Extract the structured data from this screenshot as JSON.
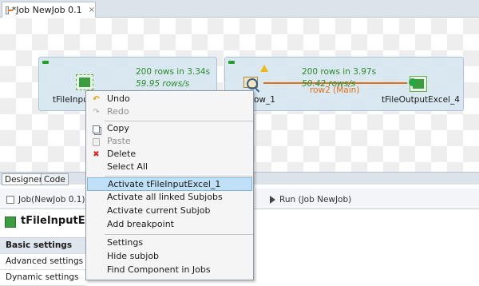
{
  "editor": {
    "tab_title": "*Job NewJob 0.1",
    "tab_close": "×"
  },
  "canvas": {
    "link1_stats": {
      "rows": "200 rows in 3.34s",
      "rate": "59.95 rows/s"
    },
    "link2_stats": {
      "rows": "200 rows in 3.97s",
      "rate": "50.42 rows/s"
    },
    "link2_label": "row2 (Main)",
    "components": [
      {
        "label": "tFileInpu"
      },
      {
        "label": "ow_1"
      },
      {
        "label": "tFileOutputExcel_4"
      }
    ]
  },
  "context_menu": {
    "items": [
      {
        "label": "Undo",
        "icon": "undo-icon",
        "enabled": true
      },
      {
        "label": "Redo",
        "icon": "redo-icon",
        "enabled": false
      },
      {
        "label": "Copy",
        "icon": "copy-icon",
        "enabled": true
      },
      {
        "label": "Paste",
        "icon": "paste-icon",
        "enabled": false
      },
      {
        "label": "Delete",
        "icon": "delete-icon",
        "enabled": true
      },
      {
        "label": "Select All",
        "enabled": true
      },
      {
        "label": "Activate tFileInputExcel_1",
        "enabled": true,
        "highlighted": true
      },
      {
        "label": "Activate all linked Subjobs",
        "enabled": true
      },
      {
        "label": "Activate current Subjob",
        "enabled": true
      },
      {
        "label": "Add breakpoint",
        "enabled": true
      },
      {
        "label": "Settings",
        "enabled": true
      },
      {
        "label": "Hide subjob",
        "enabled": true
      },
      {
        "label": "Find Component in Jobs",
        "enabled": true
      }
    ]
  },
  "bottom_tabs": {
    "designer": "Designer",
    "code": "Code"
  },
  "view_tabs": {
    "job": "Job(NewJob 0.1)",
    "run": "Run (Job NewJob)"
  },
  "component_panel": {
    "title": "tFileInputExc",
    "settings": [
      "Basic settings",
      "Advanced settings",
      "Dynamic settings"
    ]
  },
  "colors": {
    "highlight": "#bfe0f7",
    "link": "#e0711a",
    "stats": "#2d8a2d",
    "subjob": "#d6e6f0"
  }
}
